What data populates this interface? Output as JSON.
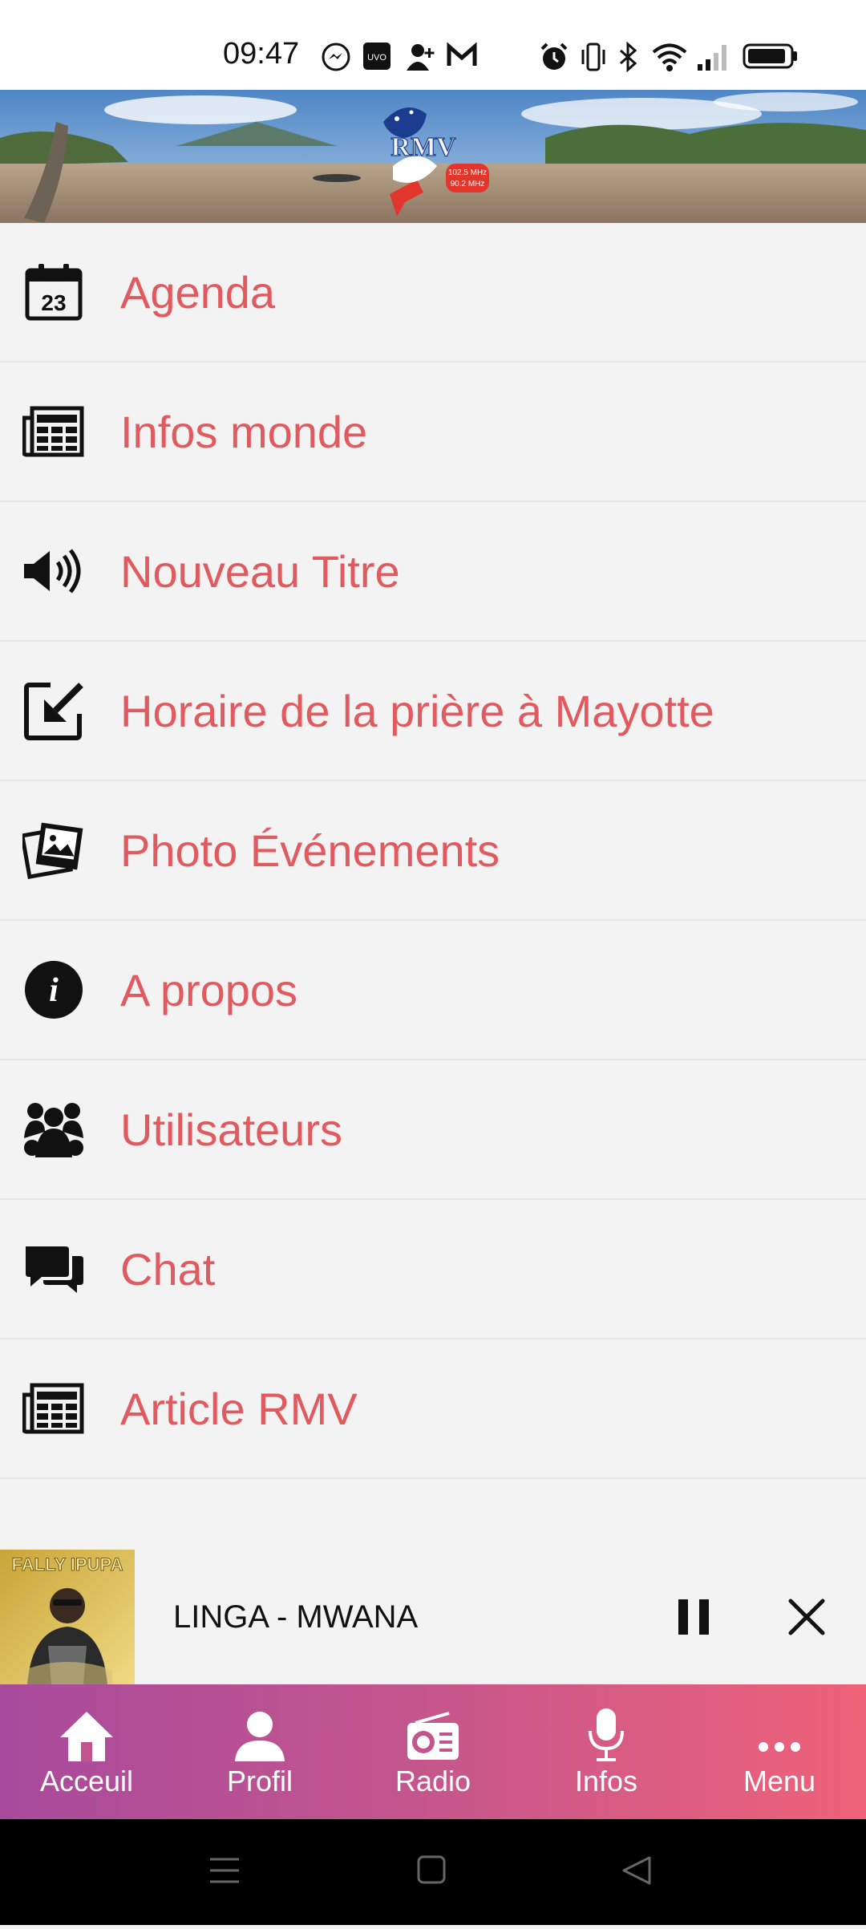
{
  "status_bar": {
    "time": "09:47",
    "icons": [
      "messenger-icon",
      "uvo-icon",
      "add-contact-icon",
      "gmail-icon",
      "alarm-icon",
      "vibrate-icon",
      "bluetooth-icon",
      "wifi-icon",
      "signal-icon",
      "battery-icon"
    ]
  },
  "banner": {
    "logo_text": "RMV",
    "freq1": "102.5 MHz",
    "freq2": "90.2 MHz"
  },
  "menu": {
    "items": [
      {
        "label": "Agenda",
        "icon": "calendar-icon",
        "icon_text": "23"
      },
      {
        "label": "Infos monde",
        "icon": "newspaper-icon"
      },
      {
        "label": "Nouveau Titre",
        "icon": "speaker-icon"
      },
      {
        "label": "Horaire de la prière à Mayotte",
        "icon": "arrow-in-box-icon"
      },
      {
        "label": "Photo Événements",
        "icon": "photos-icon"
      },
      {
        "label": "A propos",
        "icon": "info-icon",
        "icon_text": "i"
      },
      {
        "label": "Utilisateurs",
        "icon": "users-icon"
      },
      {
        "label": "Chat",
        "icon": "chat-icon"
      },
      {
        "label": "Article RMV",
        "icon": "newspaper-icon"
      }
    ]
  },
  "player": {
    "track": "LINGA - MWANA",
    "album_text": "FALLY IPUPA"
  },
  "bottom_nav": {
    "items": [
      {
        "label": "Acceuil",
        "icon": "home-icon"
      },
      {
        "label": "Profil",
        "icon": "profile-icon"
      },
      {
        "label": "Radio",
        "icon": "radio-icon"
      },
      {
        "label": "Infos",
        "icon": "microphone-icon"
      },
      {
        "label": "Menu",
        "icon": "more-icon"
      }
    ]
  },
  "colors": {
    "menu_text": "#e05a5f",
    "nav_gradient_start": "#a84a9c",
    "nav_gradient_end": "#ef6279"
  }
}
